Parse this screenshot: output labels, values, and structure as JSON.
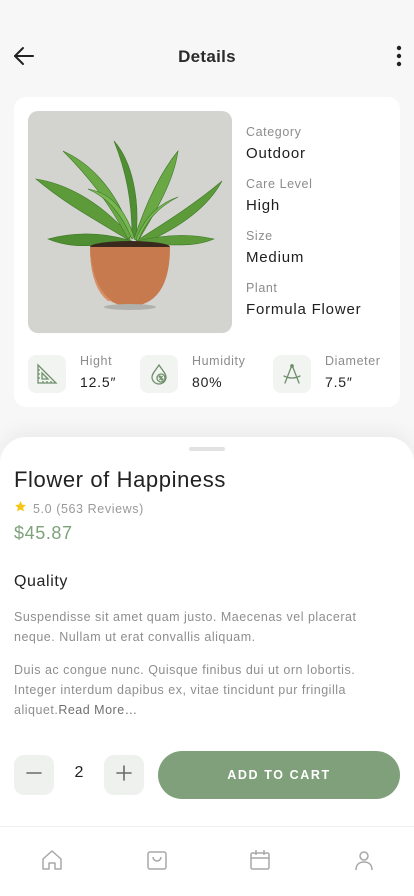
{
  "header": {
    "title": "Details",
    "back_icon": "arrow-left-icon",
    "more_icon": "more-vertical-icon"
  },
  "product_card": {
    "image_alt": "potted-plant-image",
    "specs": [
      {
        "label": "Category",
        "value": "Outdoor"
      },
      {
        "label": "Care Level",
        "value": "High"
      },
      {
        "label": "Size",
        "value": "Medium"
      },
      {
        "label": "Plant",
        "value": "Formula Flower"
      }
    ],
    "metrics": [
      {
        "icon": "ruler-triangle-icon",
        "label": "Hight",
        "value": "12.5″"
      },
      {
        "icon": "humidity-drop-icon",
        "label": "Humidity",
        "value": "80%"
      },
      {
        "icon": "compass-icon",
        "label": "Diameter",
        "value": "7.5″"
      }
    ]
  },
  "product": {
    "name": "Flower of Happiness",
    "rating": "5.0",
    "reviews": "(563 Reviews)",
    "price": "$45.87",
    "section_title": "Quality",
    "description_1": "Suspendisse sit amet quam justo. Maecenas vel placerat neque. Nullam ut erat convallis aliquam.",
    "description_2": "Duis ac congue nunc. Quisque finibus dui ut orn lobortis. Integer interdum dapibus ex, vitae tincidunt pur fringilla aliquet.",
    "read_more": "Read More…"
  },
  "cart": {
    "quantity": "2",
    "add_label": "ADD TO CART"
  },
  "bottom_nav": {
    "items": [
      "home-icon",
      "bag-icon",
      "calendar-icon",
      "profile-icon"
    ]
  },
  "colors": {
    "accent": "#7fa07a",
    "price": "#7ea27a",
    "star": "#f5c518",
    "icon_tint": "#6f8f6b"
  }
}
